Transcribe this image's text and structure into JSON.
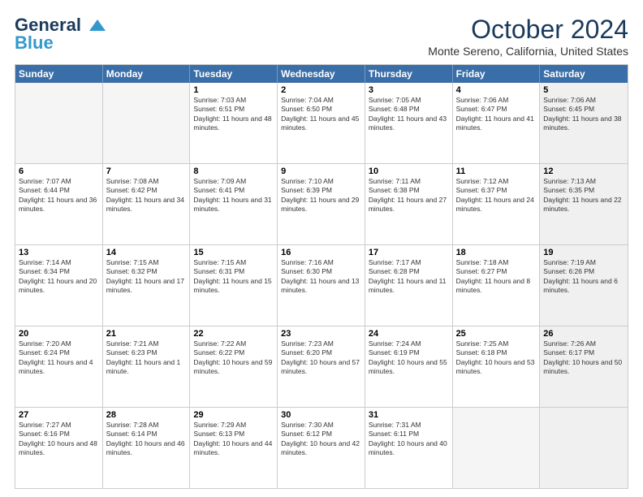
{
  "header": {
    "logo_general": "General",
    "logo_blue": "Blue",
    "title": "October 2024",
    "location": "Monte Sereno, California, United States"
  },
  "days_of_week": [
    "Sunday",
    "Monday",
    "Tuesday",
    "Wednesday",
    "Thursday",
    "Friday",
    "Saturday"
  ],
  "rows": [
    [
      {
        "day": "",
        "text": "",
        "empty": true
      },
      {
        "day": "",
        "text": "",
        "empty": true
      },
      {
        "day": "1",
        "text": "Sunrise: 7:03 AM\nSunset: 6:51 PM\nDaylight: 11 hours and 48 minutes."
      },
      {
        "day": "2",
        "text": "Sunrise: 7:04 AM\nSunset: 6:50 PM\nDaylight: 11 hours and 45 minutes."
      },
      {
        "day": "3",
        "text": "Sunrise: 7:05 AM\nSunset: 6:48 PM\nDaylight: 11 hours and 43 minutes."
      },
      {
        "day": "4",
        "text": "Sunrise: 7:06 AM\nSunset: 6:47 PM\nDaylight: 11 hours and 41 minutes."
      },
      {
        "day": "5",
        "text": "Sunrise: 7:06 AM\nSunset: 6:45 PM\nDaylight: 11 hours and 38 minutes.",
        "shaded": true
      }
    ],
    [
      {
        "day": "6",
        "text": "Sunrise: 7:07 AM\nSunset: 6:44 PM\nDaylight: 11 hours and 36 minutes."
      },
      {
        "day": "7",
        "text": "Sunrise: 7:08 AM\nSunset: 6:42 PM\nDaylight: 11 hours and 34 minutes."
      },
      {
        "day": "8",
        "text": "Sunrise: 7:09 AM\nSunset: 6:41 PM\nDaylight: 11 hours and 31 minutes."
      },
      {
        "day": "9",
        "text": "Sunrise: 7:10 AM\nSunset: 6:39 PM\nDaylight: 11 hours and 29 minutes."
      },
      {
        "day": "10",
        "text": "Sunrise: 7:11 AM\nSunset: 6:38 PM\nDaylight: 11 hours and 27 minutes."
      },
      {
        "day": "11",
        "text": "Sunrise: 7:12 AM\nSunset: 6:37 PM\nDaylight: 11 hours and 24 minutes."
      },
      {
        "day": "12",
        "text": "Sunrise: 7:13 AM\nSunset: 6:35 PM\nDaylight: 11 hours and 22 minutes.",
        "shaded": true
      }
    ],
    [
      {
        "day": "13",
        "text": "Sunrise: 7:14 AM\nSunset: 6:34 PM\nDaylight: 11 hours and 20 minutes."
      },
      {
        "day": "14",
        "text": "Sunrise: 7:15 AM\nSunset: 6:32 PM\nDaylight: 11 hours and 17 minutes."
      },
      {
        "day": "15",
        "text": "Sunrise: 7:15 AM\nSunset: 6:31 PM\nDaylight: 11 hours and 15 minutes."
      },
      {
        "day": "16",
        "text": "Sunrise: 7:16 AM\nSunset: 6:30 PM\nDaylight: 11 hours and 13 minutes."
      },
      {
        "day": "17",
        "text": "Sunrise: 7:17 AM\nSunset: 6:28 PM\nDaylight: 11 hours and 11 minutes."
      },
      {
        "day": "18",
        "text": "Sunrise: 7:18 AM\nSunset: 6:27 PM\nDaylight: 11 hours and 8 minutes."
      },
      {
        "day": "19",
        "text": "Sunrise: 7:19 AM\nSunset: 6:26 PM\nDaylight: 11 hours and 6 minutes.",
        "shaded": true
      }
    ],
    [
      {
        "day": "20",
        "text": "Sunrise: 7:20 AM\nSunset: 6:24 PM\nDaylight: 11 hours and 4 minutes."
      },
      {
        "day": "21",
        "text": "Sunrise: 7:21 AM\nSunset: 6:23 PM\nDaylight: 11 hours and 1 minute."
      },
      {
        "day": "22",
        "text": "Sunrise: 7:22 AM\nSunset: 6:22 PM\nDaylight: 10 hours and 59 minutes."
      },
      {
        "day": "23",
        "text": "Sunrise: 7:23 AM\nSunset: 6:20 PM\nDaylight: 10 hours and 57 minutes."
      },
      {
        "day": "24",
        "text": "Sunrise: 7:24 AM\nSunset: 6:19 PM\nDaylight: 10 hours and 55 minutes."
      },
      {
        "day": "25",
        "text": "Sunrise: 7:25 AM\nSunset: 6:18 PM\nDaylight: 10 hours and 53 minutes."
      },
      {
        "day": "26",
        "text": "Sunrise: 7:26 AM\nSunset: 6:17 PM\nDaylight: 10 hours and 50 minutes.",
        "shaded": true
      }
    ],
    [
      {
        "day": "27",
        "text": "Sunrise: 7:27 AM\nSunset: 6:16 PM\nDaylight: 10 hours and 48 minutes."
      },
      {
        "day": "28",
        "text": "Sunrise: 7:28 AM\nSunset: 6:14 PM\nDaylight: 10 hours and 46 minutes."
      },
      {
        "day": "29",
        "text": "Sunrise: 7:29 AM\nSunset: 6:13 PM\nDaylight: 10 hours and 44 minutes."
      },
      {
        "day": "30",
        "text": "Sunrise: 7:30 AM\nSunset: 6:12 PM\nDaylight: 10 hours and 42 minutes."
      },
      {
        "day": "31",
        "text": "Sunrise: 7:31 AM\nSunset: 6:11 PM\nDaylight: 10 hours and 40 minutes."
      },
      {
        "day": "",
        "text": "",
        "empty": true
      },
      {
        "day": "",
        "text": "",
        "empty": true,
        "shaded": true
      }
    ]
  ]
}
